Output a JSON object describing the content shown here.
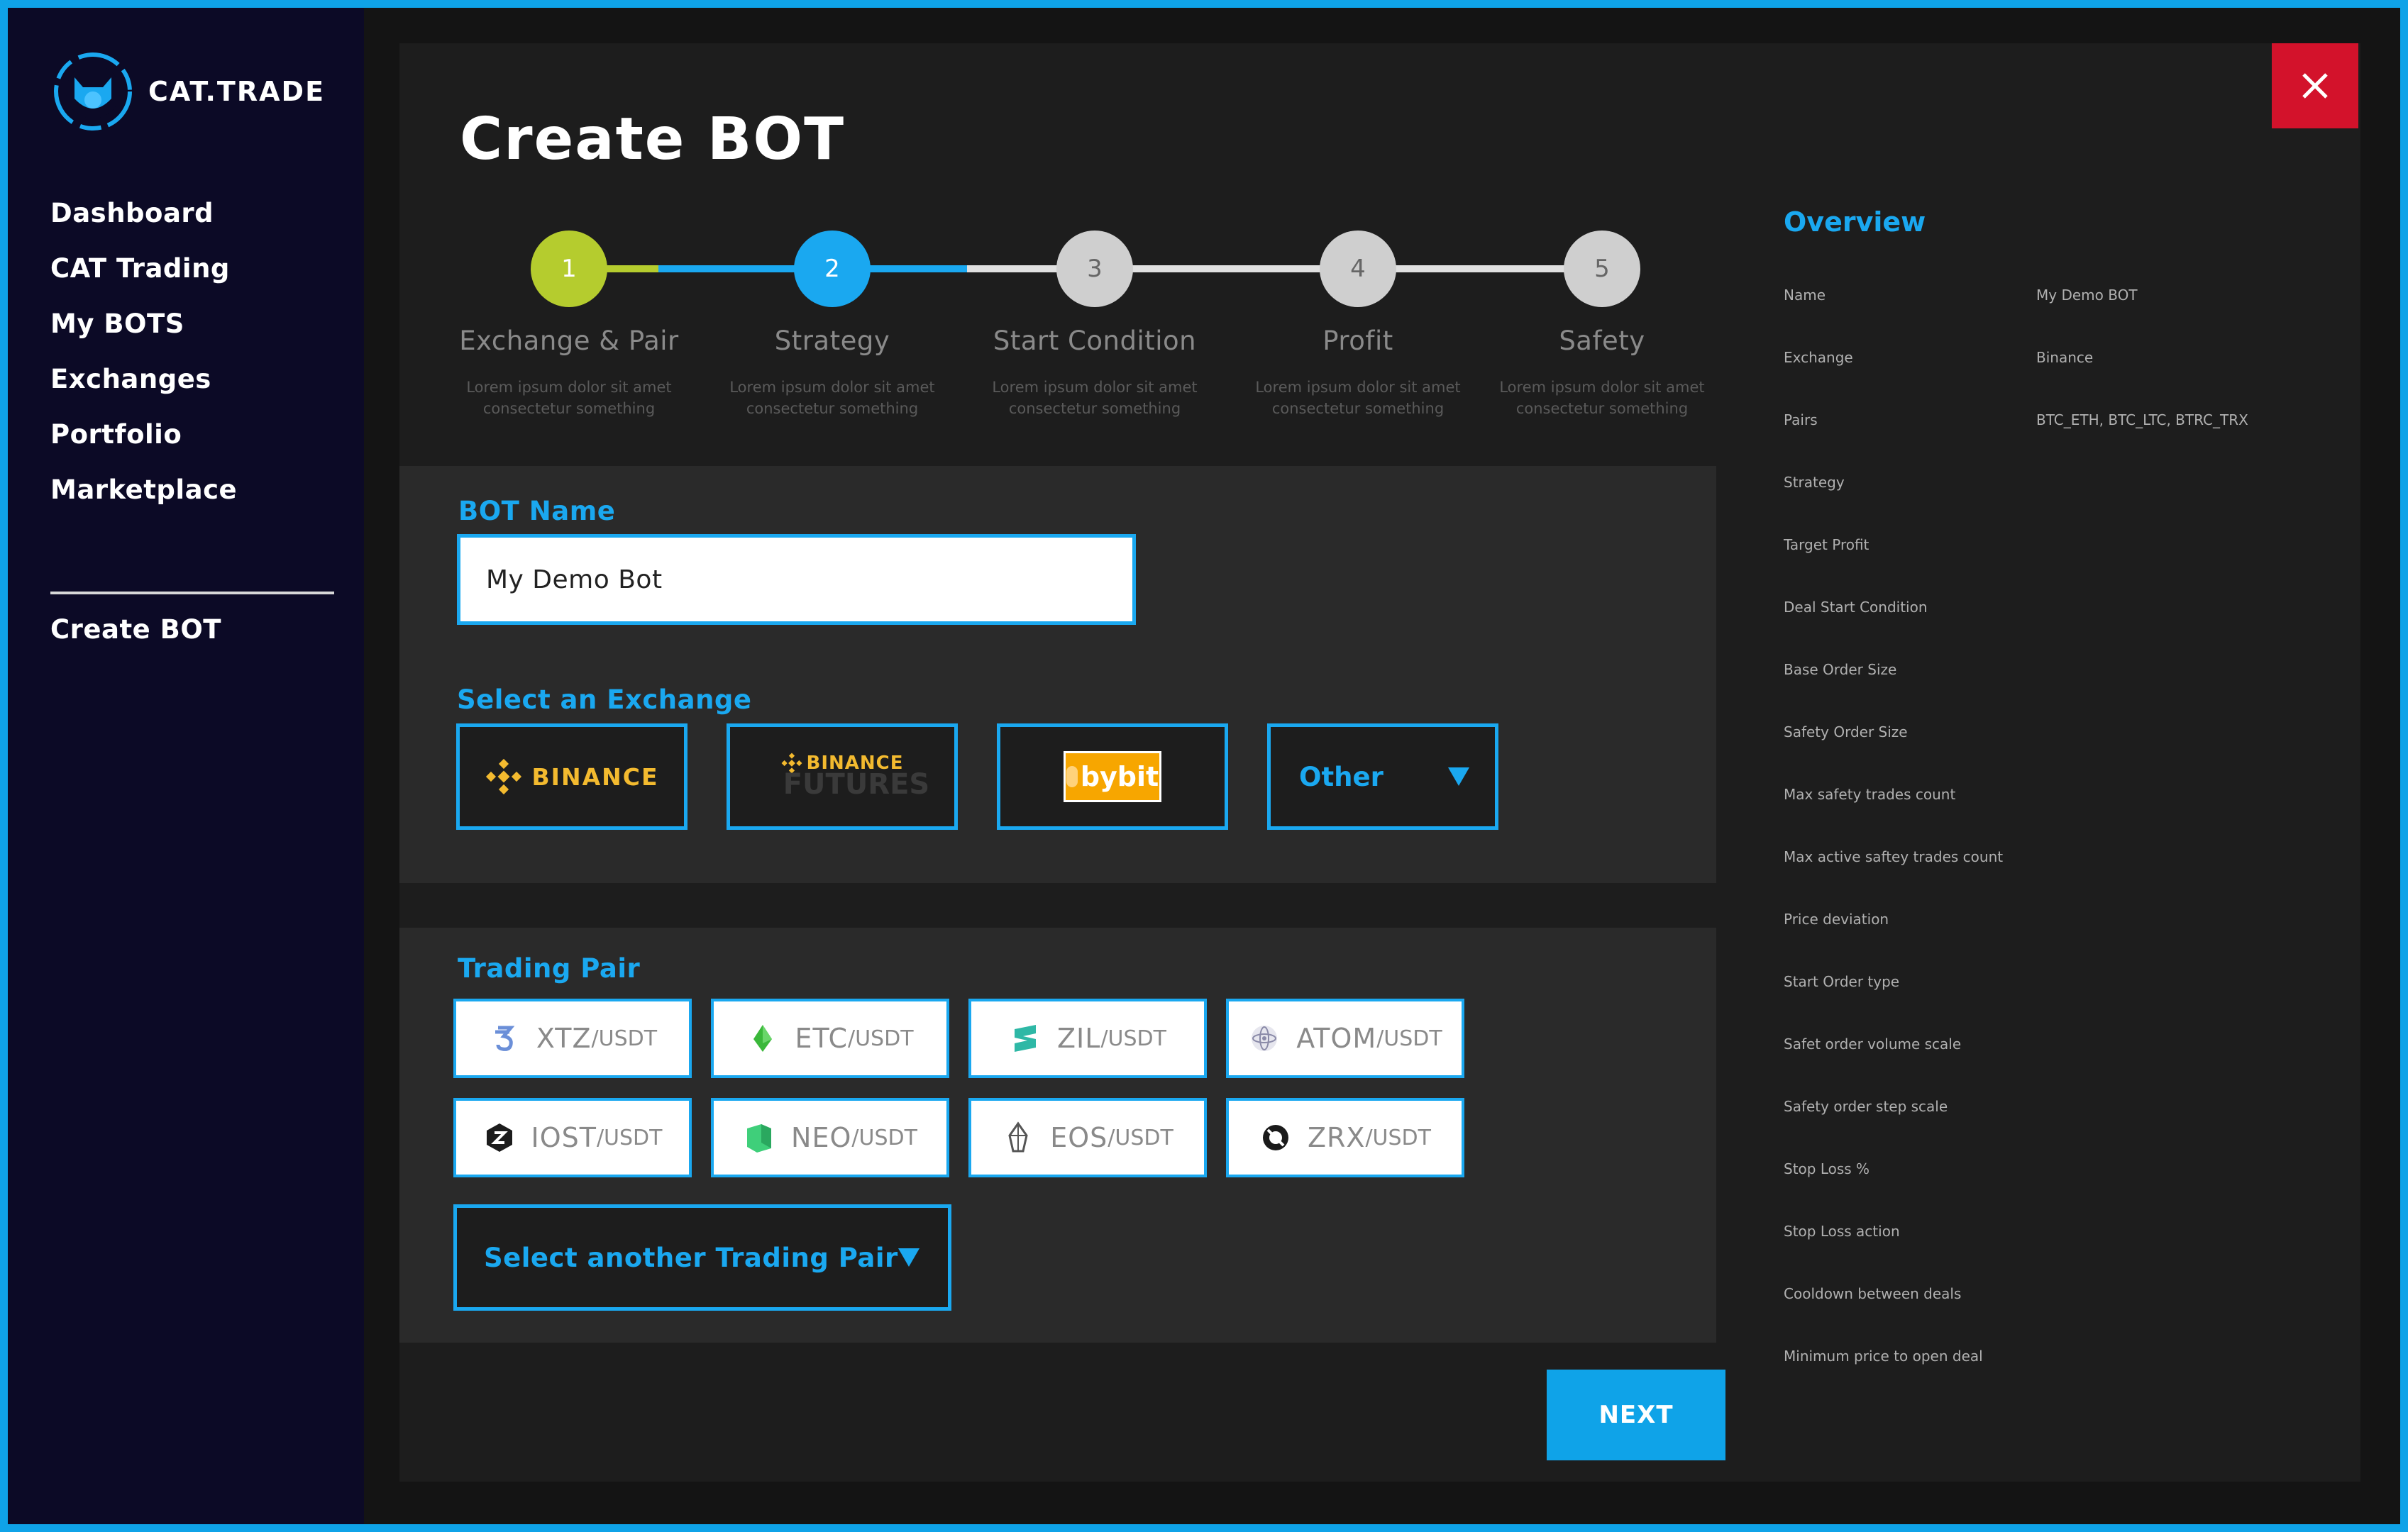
{
  "app": {
    "logo_text": "CAT.TRADE"
  },
  "sidebar": {
    "items": [
      {
        "label": "Dashboard"
      },
      {
        "label": "CAT Trading"
      },
      {
        "label": "My BOTS"
      },
      {
        "label": "Exchanges"
      },
      {
        "label": "Portfolio"
      },
      {
        "label": "Marketplace"
      }
    ],
    "create_label": "Create BOT"
  },
  "page": {
    "title": "Create BOT",
    "close_icon": "close-icon"
  },
  "steps": [
    {
      "number": "1",
      "title": "Exchange & Pair",
      "desc_line1": "Lorem ipsum dolor sit amet",
      "desc_line2": "consectetur something",
      "status": "completed",
      "color": "#b5cc2e"
    },
    {
      "number": "2",
      "title": "Strategy",
      "desc_line1": "Lorem ipsum dolor sit amet",
      "desc_line2": "consectetur something",
      "status": "current",
      "color": "#1aa8f0"
    },
    {
      "number": "3",
      "title": "Start Condition",
      "desc_line1": "Lorem ipsum dolor sit amet",
      "desc_line2": "consectetur something",
      "status": "pending",
      "color": "#d0d0d0"
    },
    {
      "number": "4",
      "title": "Profit",
      "desc_line1": "Lorem ipsum dolor sit amet",
      "desc_line2": "consectetur something",
      "status": "pending",
      "color": "#d0d0d0"
    },
    {
      "number": "5",
      "title": "Safety",
      "desc_line1": "Lorem ipsum dolor sit amet",
      "desc_line2": "consectetur something",
      "status": "pending",
      "color": "#d0d0d0"
    }
  ],
  "bot_name": {
    "label": "BOT Name",
    "value": "My Demo Bot"
  },
  "exchange": {
    "label": "Select an Exchange",
    "options": [
      {
        "name": "BINANCE",
        "icon": "binance-icon"
      },
      {
        "name": "BINANCE",
        "sub": "FUTURES",
        "icon": "binance-futures-icon"
      },
      {
        "name": "bybit",
        "icon": "bybit-icon"
      }
    ],
    "other_label": "Other"
  },
  "trading_pair": {
    "label": "Trading Pair",
    "pairs": [
      {
        "base": "XTZ",
        "quote": "/USDT",
        "icon": "tezos-icon"
      },
      {
        "base": "ETC",
        "quote": "/USDT",
        "icon": "ethereum-classic-icon"
      },
      {
        "base": "ZIL",
        "quote": "/USDT",
        "icon": "zilliqa-icon"
      },
      {
        "base": "ATOM",
        "quote": "/USDT",
        "icon": "cosmos-icon"
      },
      {
        "base": "IOST",
        "quote": "/USDT",
        "icon": "iost-icon"
      },
      {
        "base": "NEO",
        "quote": "/USDT",
        "icon": "neo-icon"
      },
      {
        "base": "EOS",
        "quote": "/USDT",
        "icon": "eos-icon"
      },
      {
        "base": "ZRX",
        "quote": "/USDT",
        "icon": "0x-icon"
      }
    ],
    "select_label": "Select another Trading Pair"
  },
  "next_label": "NEXT",
  "overview": {
    "title": "Overview",
    "rows": [
      {
        "label": "Name",
        "value": "My Demo BOT"
      },
      {
        "label": "Exchange",
        "value": "Binance"
      },
      {
        "label": "Pairs",
        "value": "BTC_ETH, BTC_LTC, BTRC_TRX"
      },
      {
        "label": "Strategy",
        "value": ""
      },
      {
        "label": "Target Profit",
        "value": ""
      },
      {
        "label": "Deal Start Condition",
        "value": ""
      },
      {
        "label": "Base Order Size",
        "value": ""
      },
      {
        "label": "Safety Order Size",
        "value": ""
      },
      {
        "label": "Max safety trades count",
        "value": ""
      },
      {
        "label": "Max active saftey trades count",
        "value": ""
      },
      {
        "label": "Price deviation",
        "value": ""
      },
      {
        "label": "Start Order type",
        "value": ""
      },
      {
        "label": "Safet order volume scale",
        "value": ""
      },
      {
        "label": "Safety order step scale",
        "value": ""
      },
      {
        "label": "Stop Loss %",
        "value": ""
      },
      {
        "label": "Stop Loss action",
        "value": ""
      },
      {
        "label": "Cooldown between deals",
        "value": ""
      },
      {
        "label": "Minimum price to open deal",
        "value": ""
      }
    ]
  },
  "colors": {
    "accent": "#1aa8f0",
    "step_done": "#b5cc2e",
    "close": "#d3122b",
    "sidebar_bg": "#0c0a26"
  }
}
